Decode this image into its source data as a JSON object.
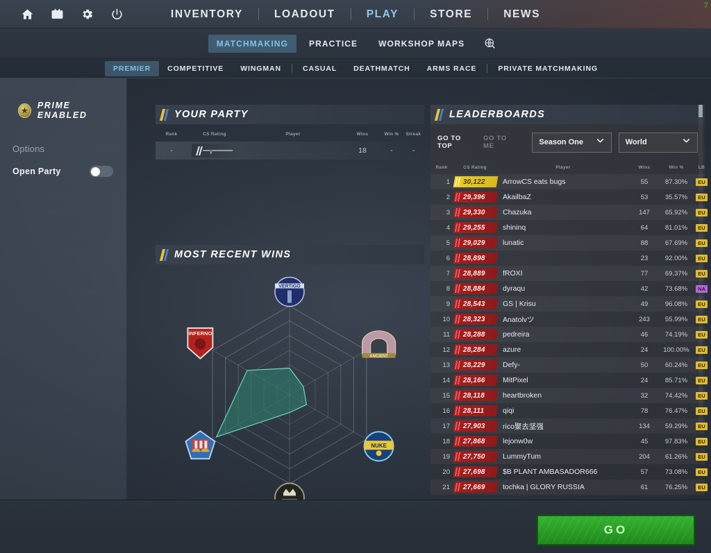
{
  "topnav": {
    "icons": [
      {
        "name": "home-icon",
        "label": "Home"
      },
      {
        "name": "watch-icon",
        "label": "Watch"
      },
      {
        "name": "settings-gear-icon",
        "label": "Settings"
      },
      {
        "name": "power-icon",
        "label": "Quit"
      }
    ],
    "links": [
      {
        "label": "INVENTORY",
        "active": false
      },
      {
        "label": "LOADOUT",
        "active": false
      },
      {
        "label": "PLAY",
        "active": true
      },
      {
        "label": "STORE",
        "active": false
      },
      {
        "label": "NEWS",
        "active": false
      }
    ],
    "corner_number": "7"
  },
  "subnav": {
    "items": [
      {
        "label": "MATCHMAKING",
        "active": true
      },
      {
        "label": "PRACTICE",
        "active": false
      },
      {
        "label": "WORKSHOP MAPS",
        "active": false
      }
    ],
    "globe_icon": "globe-search-icon"
  },
  "modetabs": [
    {
      "label": "PREMIER",
      "active": true
    },
    {
      "label": "COMPETITIVE",
      "active": false
    },
    {
      "label": "WINGMAN",
      "active": false
    },
    {
      "label": "CASUAL",
      "active": false
    },
    {
      "label": "DEATHMATCH",
      "active": false
    },
    {
      "label": "ARMS RACE",
      "active": false
    },
    {
      "label": "PRIVATE MATCHMAKING",
      "active": false
    }
  ],
  "sidebar": {
    "prime_label": "PRIME ENABLED",
    "options_label": "Options",
    "open_party_label": "Open Party",
    "open_party_on": false
  },
  "party": {
    "title": "YOUR PARTY",
    "columns": [
      "Rank",
      "CS Rating",
      "Player",
      "Wins",
      "Win %",
      "Streak"
    ],
    "row": {
      "rank": "-",
      "rating": "—,———",
      "player": "",
      "wins": "18",
      "winpct": "-",
      "streak": "-"
    }
  },
  "recent_wins": {
    "title": "MOST RECENT WINS",
    "maps": [
      {
        "name": "Vertigo",
        "icon": "map-icon-vertigo",
        "value": 0.3
      },
      {
        "name": "Ancient",
        "icon": "map-icon-ancient",
        "value": 0.18
      },
      {
        "name": "Nuke",
        "icon": "map-icon-nuke",
        "value": 0.22
      },
      {
        "name": "Overpass",
        "icon": "map-icon-overpass",
        "value": 0.2
      },
      {
        "name": "Mirage",
        "icon": "map-icon-mirage",
        "value": 0.95
      },
      {
        "name": "Inferno",
        "icon": "map-icon-inferno",
        "value": 0.55
      }
    ]
  },
  "leaderboard": {
    "title": "LEADERBOARDS",
    "go_to_top": "GO TO TOP",
    "go_to_me": "GO TO ME",
    "season_dropdown": "Season One",
    "region_dropdown": "World",
    "columns": [
      "Rank",
      "CS Rating",
      "Player",
      "Wins",
      "Win %",
      "LB"
    ],
    "rows": [
      {
        "rank": "1",
        "rating": "30,122",
        "player": "ArrowCS eats bugs",
        "wins": "55",
        "winpct": "87.30%",
        "region": "EU"
      },
      {
        "rank": "2",
        "rating": "29,396",
        "player": "AkailbaZ",
        "wins": "53",
        "winpct": "35.57%",
        "region": "EU"
      },
      {
        "rank": "3",
        "rating": "29,330",
        "player": "Chazuka",
        "wins": "147",
        "winpct": "65.92%",
        "region": "EU"
      },
      {
        "rank": "4",
        "rating": "29,255",
        "player": "shininq",
        "wins": "64",
        "winpct": "81.01%",
        "region": "EU"
      },
      {
        "rank": "5",
        "rating": "29,029",
        "player": "lunatic",
        "wins": "88",
        "winpct": "67.69%",
        "region": "EU"
      },
      {
        "rank": "6",
        "rating": "28,898",
        "player": "",
        "wins": "23",
        "winpct": "92.00%",
        "region": "EU"
      },
      {
        "rank": "7",
        "rating": "28,889",
        "player": "fROXI",
        "wins": "77",
        "winpct": "69.37%",
        "region": "EU"
      },
      {
        "rank": "8",
        "rating": "28,884",
        "player": "dyraqu",
        "wins": "42",
        "winpct": "73.68%",
        "region": "NA"
      },
      {
        "rank": "9",
        "rating": "28,543",
        "player": "GS | Krisu",
        "wins": "49",
        "winpct": "96.08%",
        "region": "EU"
      },
      {
        "rank": "10",
        "rating": "28,323",
        "player": "Anatolvツ",
        "wins": "243",
        "winpct": "55.99%",
        "region": "EU"
      },
      {
        "rank": "11",
        "rating": "28,288",
        "player": "pedreira",
        "wins": "46",
        "winpct": "74.19%",
        "region": "EU"
      },
      {
        "rank": "12",
        "rating": "28,284",
        "player": "azure",
        "wins": "24",
        "winpct": "100.00%",
        "region": "EU"
      },
      {
        "rank": "13",
        "rating": "28,229",
        "player": "Defy-",
        "wins": "50",
        "winpct": "60.24%",
        "region": "EU"
      },
      {
        "rank": "14",
        "rating": "28,166",
        "player": "MitPixel",
        "wins": "24",
        "winpct": "85.71%",
        "region": "EU"
      },
      {
        "rank": "15",
        "rating": "28,118",
        "player": "heartbroken",
        "wins": "32",
        "winpct": "74.42%",
        "region": "EU"
      },
      {
        "rank": "16",
        "rating": "28,111",
        "player": "qiqi",
        "wins": "78",
        "winpct": "76.47%",
        "region": "EU"
      },
      {
        "rank": "17",
        "rating": "27,903",
        "player": "rico聚去坚强",
        "wins": "134",
        "winpct": "59.29%",
        "region": "EU"
      },
      {
        "rank": "18",
        "rating": "27,868",
        "player": "lejonw0w",
        "wins": "45",
        "winpct": "97.83%",
        "region": "EU"
      },
      {
        "rank": "19",
        "rating": "27,750",
        "player": "LummyTum",
        "wins": "204",
        "winpct": "61.26%",
        "region": "EU"
      },
      {
        "rank": "20",
        "rating": "27,698",
        "player": "$B PLANT AMBASADOR666",
        "wins": "57",
        "winpct": "73.08%",
        "region": "EU"
      },
      {
        "rank": "21",
        "rating": "27,669",
        "player": "tochka | GLORY RUSSIA",
        "wins": "61",
        "winpct": "76.25%",
        "region": "EU"
      }
    ]
  },
  "footer": {
    "go_label": "GO"
  },
  "colors": {
    "accent_blue": "#7fc4e8",
    "rating_red": "#a61f1f",
    "rating_gold": "#ead02a",
    "region_eu": "#e0bb2e",
    "region_na": "#b763d6",
    "go_green": "#35b22e",
    "radar_fill": "#2f7d6b"
  }
}
